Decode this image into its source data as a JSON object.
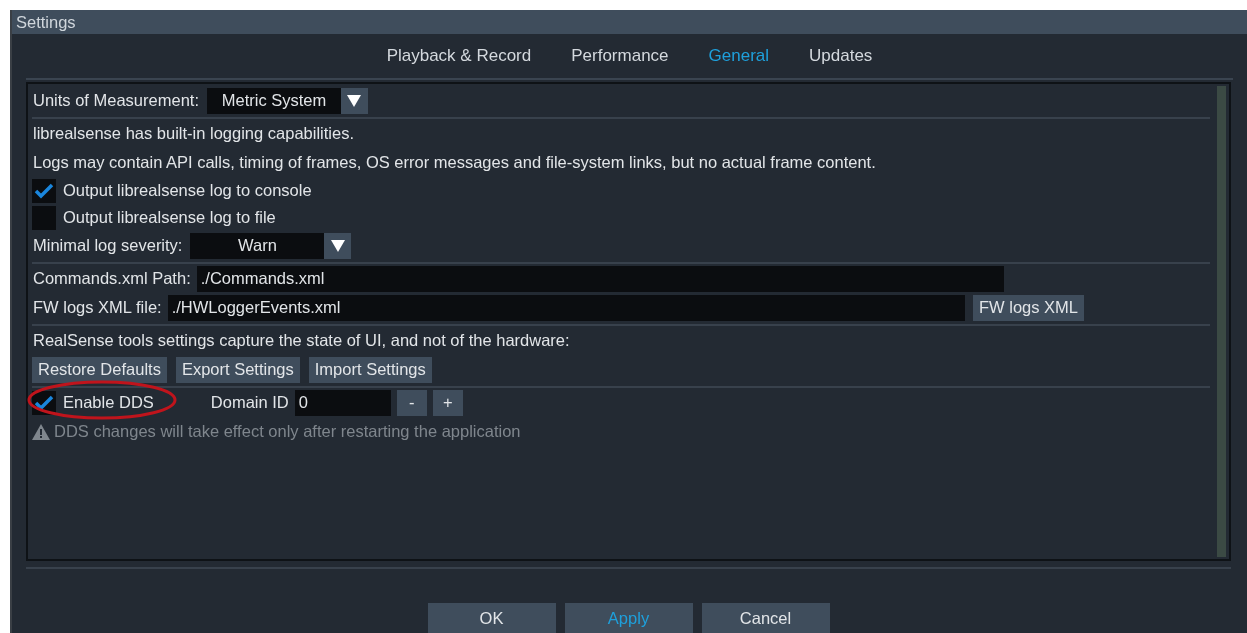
{
  "window": {
    "title": "Settings"
  },
  "tabs": [
    {
      "label": "Playback & Record",
      "selected": false
    },
    {
      "label": "Performance",
      "selected": false
    },
    {
      "label": "General",
      "selected": true
    },
    {
      "label": "Updates",
      "selected": false
    }
  ],
  "sections": [
    {
      "rows": [
        {
          "kind": "dropdown",
          "label": "Units of Measurement:",
          "value": "Metric System"
        }
      ]
    },
    {
      "rows": [
        {
          "kind": "text",
          "text": "librealsense has built-in logging capabilities."
        },
        {
          "kind": "text",
          "text": "Logs may contain API calls, timing of frames, OS error messages and file-system links, but no actual frame content."
        },
        {
          "kind": "checkbox",
          "label": "Output librealsense log to console",
          "checked": true
        },
        {
          "kind": "checkbox",
          "label": "Output librealsense log to file",
          "checked": false
        },
        {
          "kind": "dropdown",
          "label": "Minimal log severity:",
          "value": "Warn"
        }
      ]
    },
    {
      "rows": [
        {
          "kind": "path",
          "label": "Commands.xml Path:",
          "value": "./Commands.xml"
        },
        {
          "kind": "path",
          "label": "FW logs XML file:",
          "value": "./HWLoggerEvents.xml",
          "button": "FW logs XML"
        }
      ]
    },
    {
      "rows": [
        {
          "kind": "text",
          "text": "RealSense tools settings capture the state of UI, and not of the hardware:"
        },
        {
          "kind": "buttons",
          "buttons": [
            "Restore Defaults",
            "Export Settings",
            "Import Settings"
          ]
        }
      ]
    },
    {
      "rows": [
        {
          "kind": "dds",
          "label": "Enable DDS",
          "checked": true,
          "circled": true,
          "domain_label": "Domain ID",
          "domain_value": "0",
          "decrement": "-",
          "increment": "+"
        },
        {
          "kind": "warning",
          "text": "DDS changes will take effect only after restarting the application"
        }
      ]
    }
  ],
  "buttons": [
    {
      "label": "OK",
      "active": false
    },
    {
      "label": "Apply",
      "active": true
    },
    {
      "label": "Cancel",
      "active": false
    }
  ]
}
